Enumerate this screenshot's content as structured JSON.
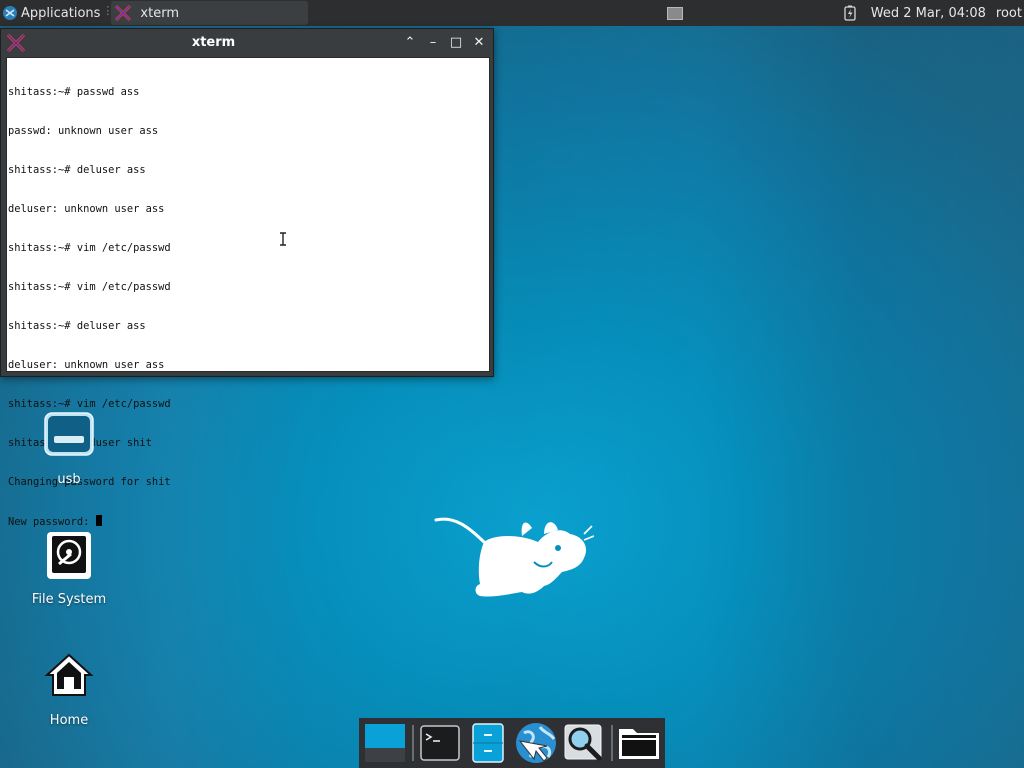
{
  "top_panel": {
    "applications_label": "Applications",
    "apps_separator": "⋮",
    "task_title": "xterm",
    "clock": "Wed  2 Mar, 04:08",
    "user": "root"
  },
  "xterm_window": {
    "title": "xterm",
    "buttons": {
      "shade": "⌃",
      "minimize": "–",
      "maximize": "□",
      "close": "✕"
    },
    "lines": [
      "shitass:~# passwd ass",
      "passwd: unknown user ass",
      "shitass:~# deluser ass",
      "deluser: unknown user ass",
      "shitass:~# vim /etc/passwd",
      "shitass:~# vim /etc/passwd",
      "shitass:~# deluser ass",
      "deluser: unknown user ass",
      "shitass:~# vim /etc/passwd",
      "shitass:~# adduser shit",
      "Changing password for shit"
    ],
    "prompt_line": "New password: "
  },
  "desktop_icons": {
    "usb": "usb",
    "file_system": "File System",
    "home": "Home"
  },
  "dock": {
    "items": [
      "show-desktop-icon",
      "terminal-icon",
      "file-manager-icon",
      "web-browser-icon",
      "app-finder-icon",
      "folder-icon"
    ]
  },
  "colors": {
    "panel": "#2c2e30",
    "wallpaper_accent": "#0aa6d6",
    "show_desktop_blue": "#0aa0d8"
  }
}
